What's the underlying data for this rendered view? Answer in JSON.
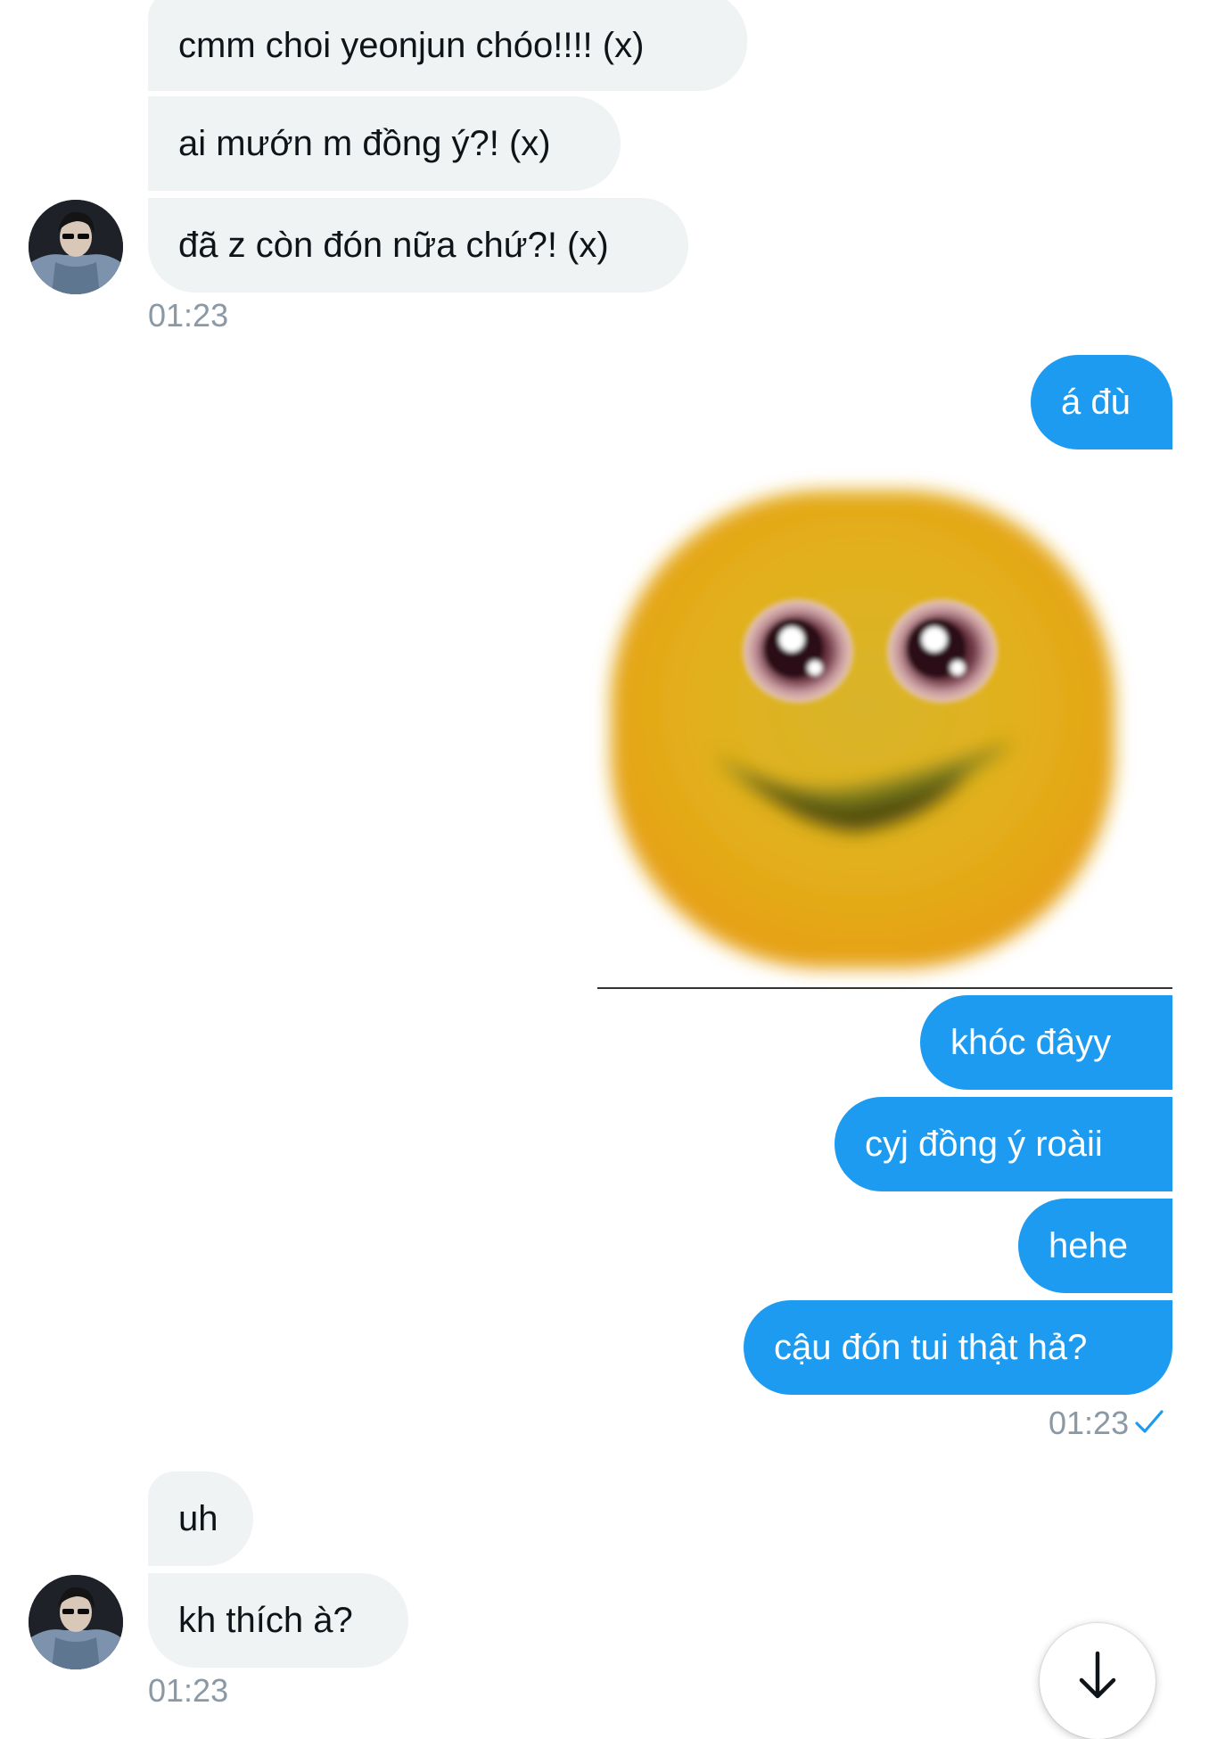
{
  "colors": {
    "incoming_bubble": "#eff3f4",
    "outgoing_bubble": "#1d9bf0",
    "timestamp": "#8b98a5",
    "read_check": "#1d9bf0"
  },
  "thread": {
    "group1": {
      "messages": [
        "cmm choi yeonjun chóo!!!! (x)",
        "ai mướn m đồng ý?! (x)",
        "đã z còn đón nữa chứ?! (x)"
      ],
      "timestamp": "01:23"
    },
    "group2": {
      "messages_top": [
        "á đù"
      ],
      "sticker": "smiling-blurry-emoji-sticker",
      "messages": [
        "khóc đâyy",
        "cyj đồng ý roàii",
        "hehe",
        "cậu đón tui thật hả?"
      ],
      "timestamp": "01:23",
      "status_icon": "check-icon"
    },
    "group3": {
      "messages": [
        "uh",
        "kh thích à?"
      ],
      "timestamp": "01:23"
    }
  },
  "scroll_button": {
    "icon": "arrow-down-icon"
  }
}
